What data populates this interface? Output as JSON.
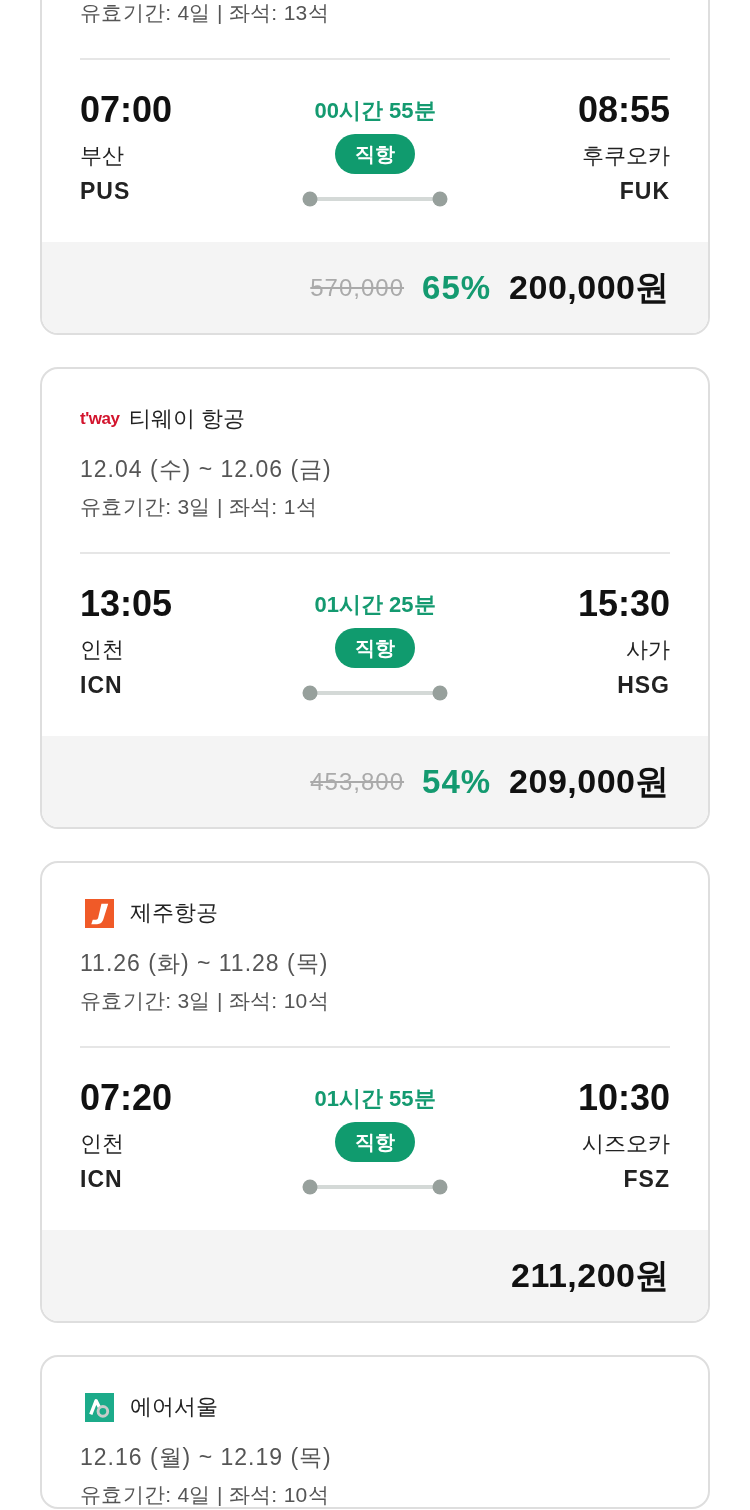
{
  "flights": [
    {
      "validity": "유효기간: 4일 | 좌석: 13석",
      "flight": {
        "departure": {
          "time": "07:00",
          "city": "부산",
          "code": "PUS"
        },
        "duration": "00시간 55분",
        "stop_label": "직항",
        "arrival": {
          "time": "08:55",
          "city": "후쿠오카",
          "code": "FUK"
        }
      },
      "price": {
        "original": "570,000",
        "discount": "65%",
        "final": "200,000원"
      }
    },
    {
      "airline": {
        "name": "티웨이 항공",
        "logo": {
          "kind": "wordmark",
          "text": "t'way"
        }
      },
      "dates": "12.04 (수) ~ 12.06 (금)",
      "validity": "유효기간: 3일 | 좌석: 1석",
      "flight": {
        "departure": {
          "time": "13:05",
          "city": "인천",
          "code": "ICN"
        },
        "duration": "01시간 25분",
        "stop_label": "직항",
        "arrival": {
          "time": "15:30",
          "city": "사가",
          "code": "HSG"
        }
      },
      "price": {
        "original": "453,800",
        "discount": "54%",
        "final": "209,000원"
      }
    },
    {
      "airline": {
        "name": "제주항공",
        "logo": {
          "kind": "hook"
        }
      },
      "dates": "11.26 (화) ~ 11.28 (목)",
      "validity": "유효기간: 3일 | 좌석: 10석",
      "flight": {
        "departure": {
          "time": "07:20",
          "city": "인천",
          "code": "ICN"
        },
        "duration": "01시간 55분",
        "stop_label": "직항",
        "arrival": {
          "time": "10:30",
          "city": "시즈오카",
          "code": "FSZ"
        }
      },
      "price": {
        "final": "211,200원"
      }
    },
    {
      "airline": {
        "name": "에어서울",
        "logo": {
          "kind": "ring"
        }
      },
      "dates": "12.16 (월) ~ 12.19 (목)",
      "validity": "유효기간: 4일 | 좌석: 10석"
    }
  ]
}
